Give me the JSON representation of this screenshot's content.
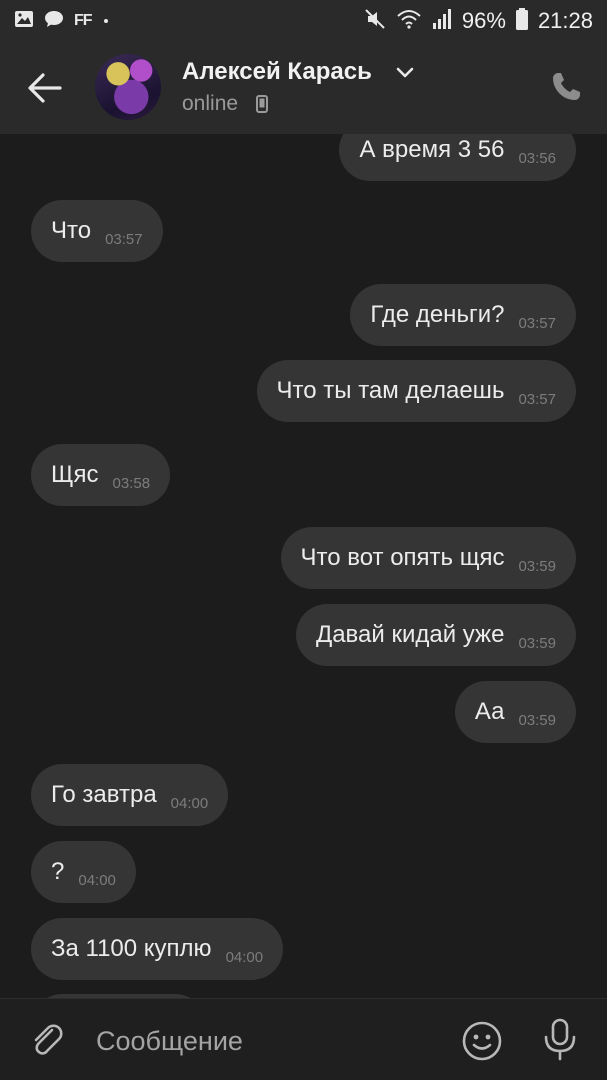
{
  "status_bar": {
    "icons_left": [
      "gallery-icon",
      "chat-icon",
      "ff-icon",
      "dot-icon"
    ],
    "ff_label": "FF",
    "icons_right": [
      "mute-icon",
      "wifi-icon",
      "signal-icon",
      "battery-icon"
    ],
    "battery": "96%",
    "time": "21:28"
  },
  "header": {
    "contact_name": "Алексей Карась",
    "status": "online"
  },
  "messages": [
    {
      "direction": "out",
      "text": "А время 3 56",
      "time": "03:56"
    },
    {
      "direction": "in",
      "text": "Что",
      "time": "03:57"
    },
    {
      "direction": "out",
      "text": "Где деньги?",
      "time": "03:57"
    },
    {
      "direction": "out",
      "text": "Что ты там делаешь",
      "time": "03:57"
    },
    {
      "direction": "in",
      "text": "Щяс",
      "time": "03:58"
    },
    {
      "direction": "out",
      "text": "Что вот опять щяс",
      "time": "03:59"
    },
    {
      "direction": "out",
      "text": "Давай кидай уже",
      "time": "03:59"
    },
    {
      "direction": "out",
      "text": "Аа",
      "time": "03:59"
    },
    {
      "direction": "in",
      "text": "Го завтра",
      "time": "04:00"
    },
    {
      "direction": "in",
      "text": "?",
      "time": "04:00"
    },
    {
      "direction": "in",
      "text": "За 1100 куплю",
      "time": "04:00"
    }
  ],
  "composer": {
    "placeholder": "Сообщение"
  },
  "colors": {
    "background": "#1c1c1c",
    "bar": "#2a2a2b",
    "bubble": "#353536",
    "muted": "#9a9a9a"
  }
}
